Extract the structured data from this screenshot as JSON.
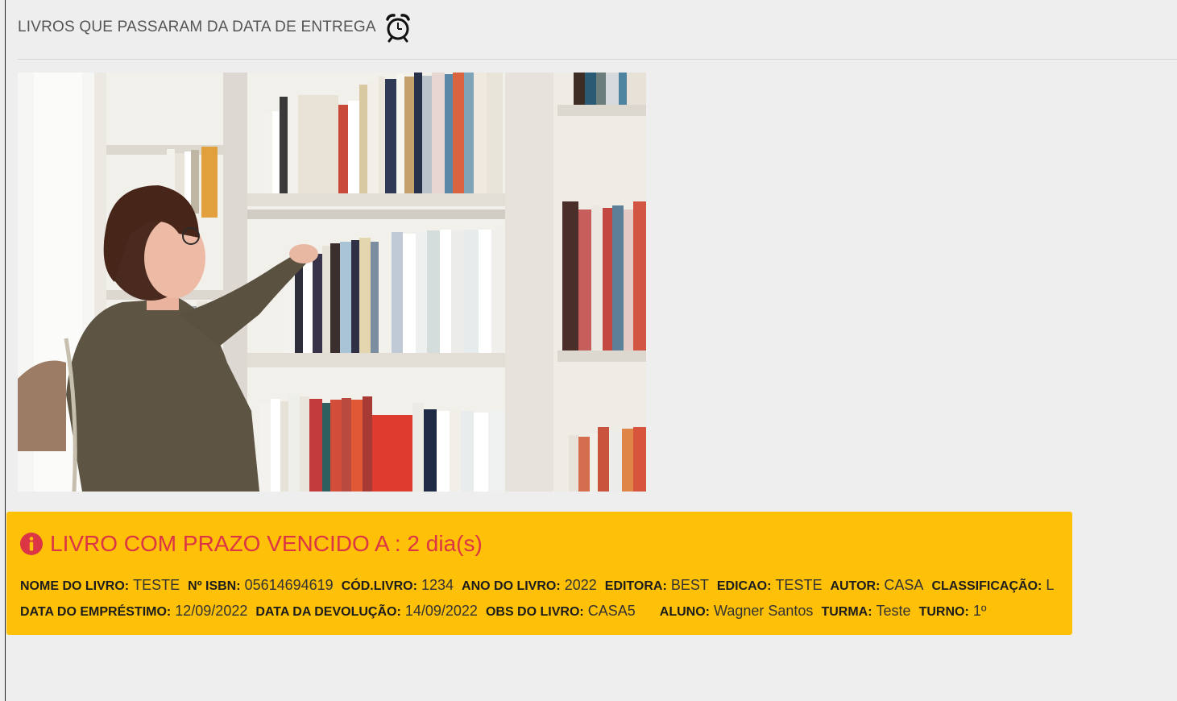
{
  "header": {
    "title": "LIVROS QUE PASSARAM DA DATA DE ENTREGA",
    "icon": "alarm-clock-icon"
  },
  "hero_image": {
    "description_icon": "library-photo"
  },
  "alert": {
    "icon": "info-circle-icon",
    "title": "LIVRO COM PRAZO VENCIDO A : 2 dia(s)",
    "colors": {
      "background": "#ffc107",
      "title": "#dc3545"
    },
    "fields": [
      {
        "label": "NOME DO LIVRO:",
        "value": "TESTE"
      },
      {
        "label": "Nº ISBN:",
        "value": "05614694619"
      },
      {
        "label": "CÓD.LIVRO:",
        "value": "1234"
      },
      {
        "label": "ANO DO LIVRO:",
        "value": "2022"
      },
      {
        "label": "EDITORA:",
        "value": "BEST"
      },
      {
        "label": "EDICAO:",
        "value": "TESTE"
      },
      {
        "label": "AUTOR:",
        "value": "CASA"
      },
      {
        "label": "CLASSIFICAÇÃO:",
        "value": "L"
      },
      {
        "label": "DATA DO EMPRÉSTIMO:",
        "value": "12/09/2022"
      },
      {
        "label": "DATA DA DEVOLUÇÃO:",
        "value": "14/09/2022"
      },
      {
        "label": "OBS DO LIVRO:",
        "value": "CASA5"
      },
      {
        "label": "ALUNO:",
        "value": "Wagner Santos"
      },
      {
        "label": "TURMA:",
        "value": "Teste"
      },
      {
        "label": "TURNO:",
        "value": "1º"
      }
    ]
  }
}
